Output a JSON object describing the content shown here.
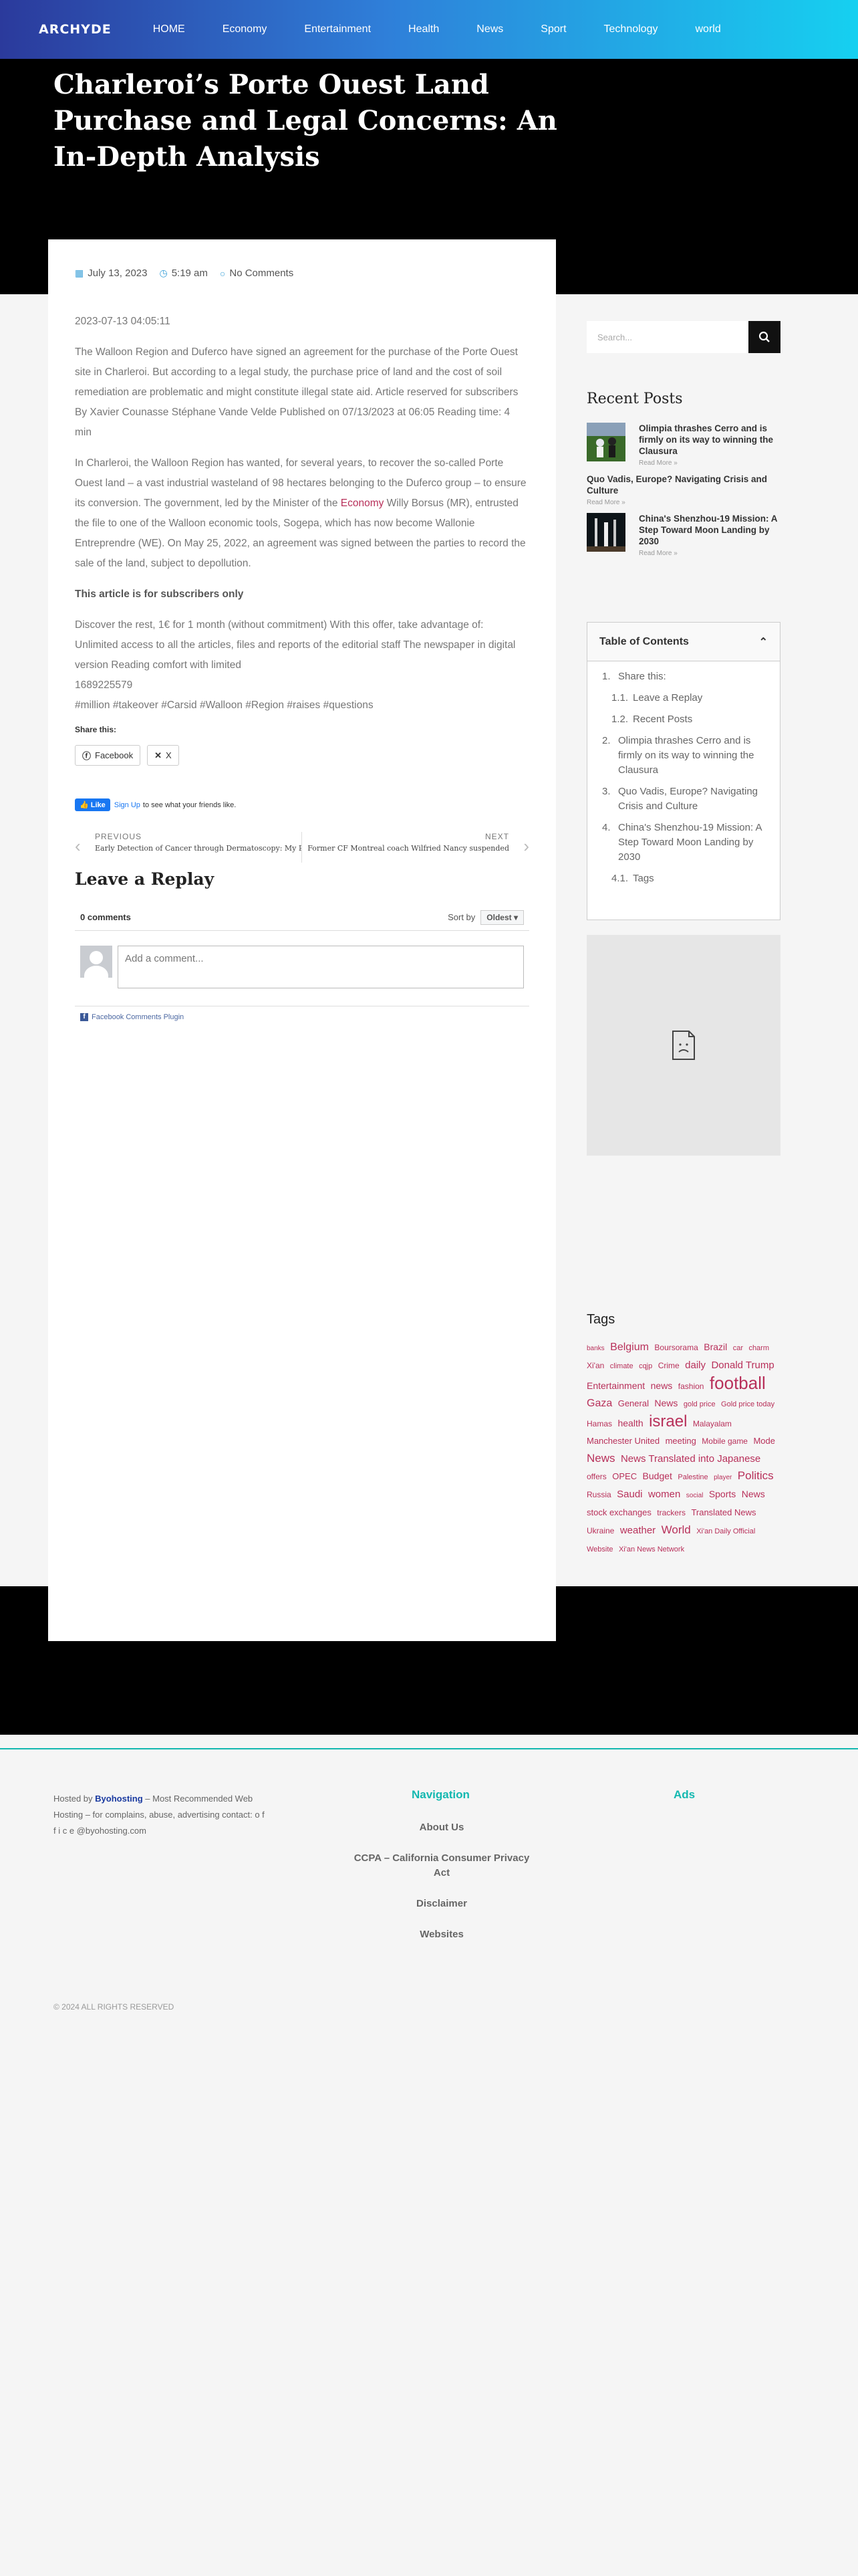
{
  "header": {
    "logo": "ARCHYDE",
    "nav": [
      "HOME",
      "Economy",
      "Entertainment",
      "Health",
      "News",
      "Sport",
      "Technology",
      "world"
    ]
  },
  "article": {
    "title": "Charleroi’s Porte Ouest Land Purchase and Legal Concerns: An In-Depth Analysis",
    "date": "July 13, 2023",
    "time": "5:19 am",
    "comments": "No Comments",
    "stamp": "2023-07-13 04:05:11",
    "p1": "The Walloon Region and Duferco have signed an agreement for the purchase of the Porte Ouest site in Charleroi. But according to a legal study, the purchase price of land and the cost of soil remediation are problematic and might constitute illegal state aid. Article reserved for subscribers By Xavier Counasse Stéphane Vande Velde Published on 07/13/2023 at 06:05 Reading time: 4 min",
    "p2_a": "In Charleroi, the Walloon Region has wanted, for several years, to recover the so-called Porte Ouest land – a vast industrial wasteland of 98 hectares belonging to the Duferco group – to ensure its conversion. The government, led by the Minister of the ",
    "p2_link": "Economy",
    "p2_b": " Willy Borsus (MR), entrusted the file to one of the Walloon economic tools, Sogepa, which has now become Wallonie Entreprendre (WE). On May 25, 2022, an agreement was signed between the parties to record the sale of the land, subject to depollution.",
    "p3": "This article is for subscribers only",
    "p4": "Discover the rest, 1€ for 1 month (without commitment) With this offer, take advantage of: Unlimited access to all the articles, files and reports of the editorial staff The newspaper in digital version Reading comfort with limited",
    "p5": "1689225579",
    "p6": "#million #takeover #Carsid #Walloon #Region #raises #questions",
    "share_label": "Share this:",
    "share_facebook": "Facebook",
    "share_x": "X",
    "like_btn": "Like",
    "like_signup": "Sign Up",
    "like_text": "to see what your friends like.",
    "prev_label": "PREVIOUS",
    "prev_title": "Early Detection of Cancer through Dermatoscopy: My Per...",
    "next_label": "NEXT",
    "next_title": "Former CF Montreal coach Wilfried Nancy suspended",
    "reply_title": "Leave a Replay",
    "fb_count": "0 comments",
    "fb_sort_label": "Sort by",
    "fb_sort_value": "Oldest",
    "fb_placeholder": "Add a comment...",
    "fb_plugin": "Facebook Comments Plugin"
  },
  "sidebar": {
    "search_placeholder": "Search...",
    "recent_title": "Recent Posts",
    "recent": [
      {
        "title": "Olimpia thrashes Cerro and is firmly on its way to winning the Clausura",
        "more": "Read More »"
      },
      {
        "title": "Quo Vadis, Europe? Navigating Crisis and Culture",
        "more": "Read More »"
      },
      {
        "title": "China's Shenzhou-19 Mission: A Step Toward Moon Landing by 2030",
        "more": "Read More »"
      }
    ],
    "toc_title": "Table of Contents",
    "toc": [
      {
        "n": "1.",
        "t": "Share this:",
        "sub": false
      },
      {
        "n": "1.1.",
        "t": "Leave a Replay",
        "sub": true
      },
      {
        "n": "1.2.",
        "t": "Recent Posts",
        "sub": true
      },
      {
        "n": "2.",
        "t": "Olimpia thrashes Cerro and is firmly on its way to winning the Clausura",
        "sub": false
      },
      {
        "n": "3.",
        "t": "Quo Vadis, Europe? Navigating Crisis and Culture",
        "sub": false
      },
      {
        "n": "4.",
        "t": "China's Shenzhou-19 Mission: A Step Toward Moon Landing by 2030",
        "sub": false
      },
      {
        "n": "4.1.",
        "t": "Tags",
        "sub": true
      }
    ],
    "tags_title": "Tags",
    "tags": [
      {
        "t": "banks",
        "s": 10
      },
      {
        "t": "Belgium",
        "s": 16
      },
      {
        "t": "Boursorama",
        "s": 12
      },
      {
        "t": "Brazil",
        "s": 14
      },
      {
        "t": "car",
        "s": 11
      },
      {
        "t": "charm",
        "s": 11
      },
      {
        "t": "Xi'an",
        "s": 12
      },
      {
        "t": "climate",
        "s": 11
      },
      {
        "t": "cqjp",
        "s": 11
      },
      {
        "t": "Crime",
        "s": 12
      },
      {
        "t": "daily",
        "s": 15
      },
      {
        "t": "Donald Trump",
        "s": 15
      },
      {
        "t": "Entertainment",
        "s": 14
      },
      {
        "t": "news",
        "s": 14
      },
      {
        "t": "fashion",
        "s": 12
      },
      {
        "t": "football",
        "s": 26
      },
      {
        "t": "Gaza",
        "s": 16
      },
      {
        "t": "General",
        "s": 13
      },
      {
        "t": "News",
        "s": 14
      },
      {
        "t": "gold price",
        "s": 11
      },
      {
        "t": "Gold price today",
        "s": 11
      },
      {
        "t": "Hamas",
        "s": 12
      },
      {
        "t": "health",
        "s": 14
      },
      {
        "t": "israel",
        "s": 24
      },
      {
        "t": "Malayalam",
        "s": 12
      },
      {
        "t": "Manchester United",
        "s": 13
      },
      {
        "t": "meeting",
        "s": 13
      },
      {
        "t": "Mobile game",
        "s": 12
      },
      {
        "t": "Mode",
        "s": 13
      },
      {
        "t": "News",
        "s": 17
      },
      {
        "t": "News Translated into Japanese",
        "s": 15
      },
      {
        "t": "offers",
        "s": 12
      },
      {
        "t": "OPEC",
        "s": 13
      },
      {
        "t": "Budget",
        "s": 14
      },
      {
        "t": "Palestine",
        "s": 11
      },
      {
        "t": "player",
        "s": 10
      },
      {
        "t": "Politics",
        "s": 17
      },
      {
        "t": "Russia",
        "s": 12
      },
      {
        "t": "Saudi",
        "s": 15
      },
      {
        "t": "women",
        "s": 15
      },
      {
        "t": "social",
        "s": 10
      },
      {
        "t": "Sports",
        "s": 14
      },
      {
        "t": "News",
        "s": 14
      },
      {
        "t": "stock exchanges",
        "s": 13
      },
      {
        "t": "trackers",
        "s": 12
      },
      {
        "t": "Translated News",
        "s": 13
      },
      {
        "t": "Ukraine",
        "s": 12
      },
      {
        "t": "weather",
        "s": 15
      },
      {
        "t": "World",
        "s": 17
      },
      {
        "t": "Xi'an Daily Official Website",
        "s": 11
      },
      {
        "t": "Xi'an News Network",
        "s": 11
      }
    ]
  },
  "footer": {
    "host_prefix": "Hosted by ",
    "host_name": "Byohosting",
    "host_rest": " – Most Recommended Web Hosting – for complains, abuse, advertising contact: o f f i c e @byohosting.com",
    "nav_title": "Navigation",
    "ads_title": "Ads",
    "links": [
      "About Us",
      "CCPA – California Consumer Privacy Act",
      "Disclaimer",
      "Websites"
    ],
    "copyright": "© 2024 ALL RIGHTS RESERVED"
  },
  "colors": {
    "accent": "#13b8b0",
    "link": "#b8305a",
    "header_start": "#2b3a9c",
    "header_end": "#16d0f0"
  }
}
